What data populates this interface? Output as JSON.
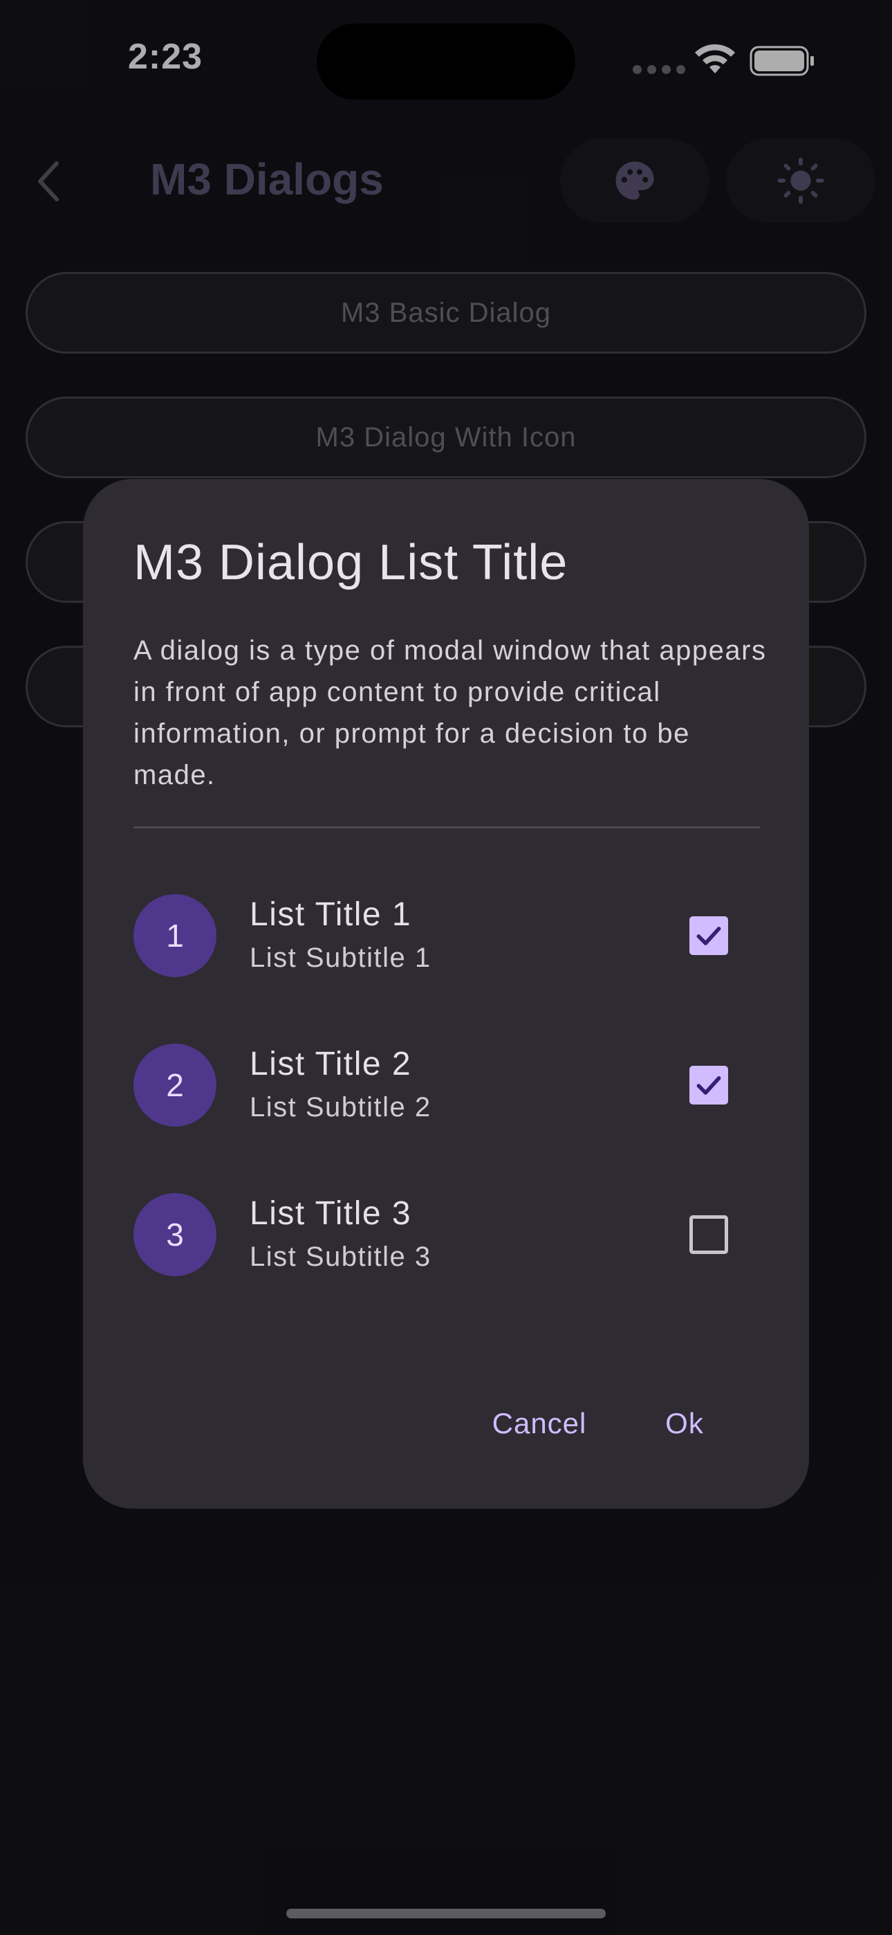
{
  "status_bar": {
    "time": "2:23"
  },
  "app_bar": {
    "title": "M3 Dialogs",
    "actions": [
      {
        "icon": "palette-icon"
      },
      {
        "icon": "brightness-icon"
      }
    ]
  },
  "background_buttons": [
    {
      "label": "M3 Basic Dialog"
    },
    {
      "label": "M3 Dialog With Icon"
    },
    {
      "label": ""
    },
    {
      "label": ""
    }
  ],
  "dialog": {
    "title": "M3 Dialog List Title",
    "body": "A dialog is a type of modal window that appears in front of app content to provide critical information, or prompt for a decision to be made.",
    "items": [
      {
        "avatar": "1",
        "title": "List Title 1",
        "subtitle": "List Subtitle 1",
        "checked": true
      },
      {
        "avatar": "2",
        "title": "List Title 2",
        "subtitle": "List Subtitle 2",
        "checked": true
      },
      {
        "avatar": "3",
        "title": "List Title 3",
        "subtitle": "List Subtitle 3",
        "checked": false
      }
    ],
    "cancel_label": "Cancel",
    "ok_label": "Ok"
  },
  "colors": {
    "primary": "#d0bcff",
    "avatar_bg": "#4f378b",
    "surface": "#2e2b33",
    "background": "#141318"
  }
}
